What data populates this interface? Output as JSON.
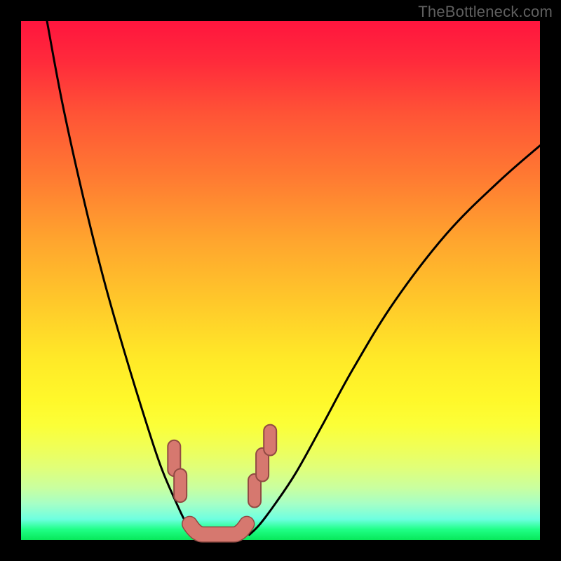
{
  "watermark": "TheBottleneck.com",
  "chart_data": {
    "type": "line",
    "title": "",
    "xlabel": "",
    "ylabel": "",
    "xlim": [
      0,
      100
    ],
    "ylim": [
      0,
      100
    ],
    "grid": false,
    "legend": false,
    "series": [
      {
        "name": "curve-left",
        "x": [
          5,
          8,
          12,
          16,
          20,
          24,
          27,
          30,
          32,
          34
        ],
        "y": [
          100,
          84,
          66,
          50,
          36,
          23,
          14,
          7,
          3,
          1
        ]
      },
      {
        "name": "curve-right",
        "x": [
          44,
          46,
          49,
          53,
          58,
          64,
          72,
          82,
          92,
          100
        ],
        "y": [
          1,
          3,
          7,
          13,
          22,
          33,
          46,
          59,
          69,
          76
        ]
      },
      {
        "name": "bottom-flat",
        "x": [
          34,
          36,
          39,
          42,
          44
        ],
        "y": [
          1,
          0.5,
          0.5,
          0.5,
          1
        ]
      }
    ],
    "markers": {
      "color": "#d6786f",
      "stroke": "#914a43",
      "sets": [
        {
          "name": "left-pair",
          "shape": "capsule-v",
          "points": [
            {
              "x": 29.5,
              "y_top": 18,
              "y_bot": 13.5
            },
            {
              "x": 30.7,
              "y_top": 12.5,
              "y_bot": 8.5
            }
          ]
        },
        {
          "name": "right-triple",
          "shape": "capsule-v",
          "points": [
            {
              "x": 45.0,
              "y_top": 11.5,
              "y_bot": 7.5
            },
            {
              "x": 46.5,
              "y_top": 16.5,
              "y_bot": 12.5
            },
            {
              "x": 48.0,
              "y_top": 21.0,
              "y_bot": 17.5
            }
          ]
        },
        {
          "name": "bottom-bar",
          "shape": "capsule-h",
          "x_left": 32.5,
          "x_right": 43.5,
          "y": 1.2,
          "left_tilt_up": true,
          "right_tilt_up": true
        }
      ]
    },
    "background_gradient": {
      "top": "#ff153e",
      "mid": "#ffe928",
      "bottom": "#08e85a"
    }
  }
}
